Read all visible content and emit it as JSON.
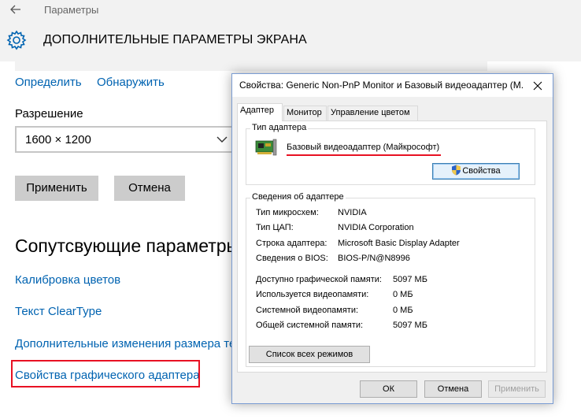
{
  "settings": {
    "titlebar": "Параметры",
    "page_title": "ДОПОЛНИТЕЛЬНЫЕ ПАРАМЕТРЫ ЭКРАНА",
    "identify": "Определить",
    "detect": "Обнаружить",
    "resolution_label": "Разрешение",
    "resolution_value": "1600 × 1200",
    "apply": "Применить",
    "cancel": "Отмена",
    "related_title": "Сопутсвующие параметры",
    "related_links": [
      "Калибровка цветов",
      "Текст ClearType",
      "Дополнительные изменения размера текста",
      "Свойства графического адаптера"
    ],
    "icons": {
      "back": "back-arrow-icon",
      "settings": "gear-icon",
      "dropdown": "chevron-down-icon"
    },
    "accent_color": "#0063b1",
    "highlight_color": "#e81123"
  },
  "dialog": {
    "title": "Свойства: Generic Non-PnP Monitor и Базовый видеоадаптер (Майкрософт)",
    "title_display": "Свойства: Generic Non-PnP Monitor и Базовый видеоадаптер (М...",
    "tabs": [
      "Адаптер",
      "Монитор",
      "Управление цветом"
    ],
    "active_tab": "Адаптер",
    "adapter_type_group": "Тип адаптера",
    "adapter_name": "Базовый видеоадаптер (Майкрософт)",
    "properties_button": "Свойства",
    "adapter_info_group": "Сведения об адаптере",
    "info": [
      {
        "label": "Тип микросхем:",
        "value": "NVIDIA"
      },
      {
        "label": "Тип ЦАП:",
        "value": "NVIDIA Corporation"
      },
      {
        "label": "Строка адаптера:",
        "value": "Microsoft Basic Display Adapter"
      },
      {
        "label": "Сведения о BIOS:",
        "value": "BIOS-P/N@N8996"
      }
    ],
    "memory": [
      {
        "label": "Доступно графической памяти:",
        "value": "5097 МБ"
      },
      {
        "label": "Используется видеопамяти:",
        "value": "0 МБ"
      },
      {
        "label": "Системной видеопамяти:",
        "value": "0 МБ"
      },
      {
        "label": "Общей системной памяти:",
        "value": "5097 МБ"
      }
    ],
    "list_modes_button": "Список всех режимов",
    "ok": "ОК",
    "cancel": "Отмена",
    "apply": "Применить",
    "icons": {
      "close": "close-icon",
      "adapter": "video-card-icon",
      "uac": "uac-shield-icon"
    }
  }
}
